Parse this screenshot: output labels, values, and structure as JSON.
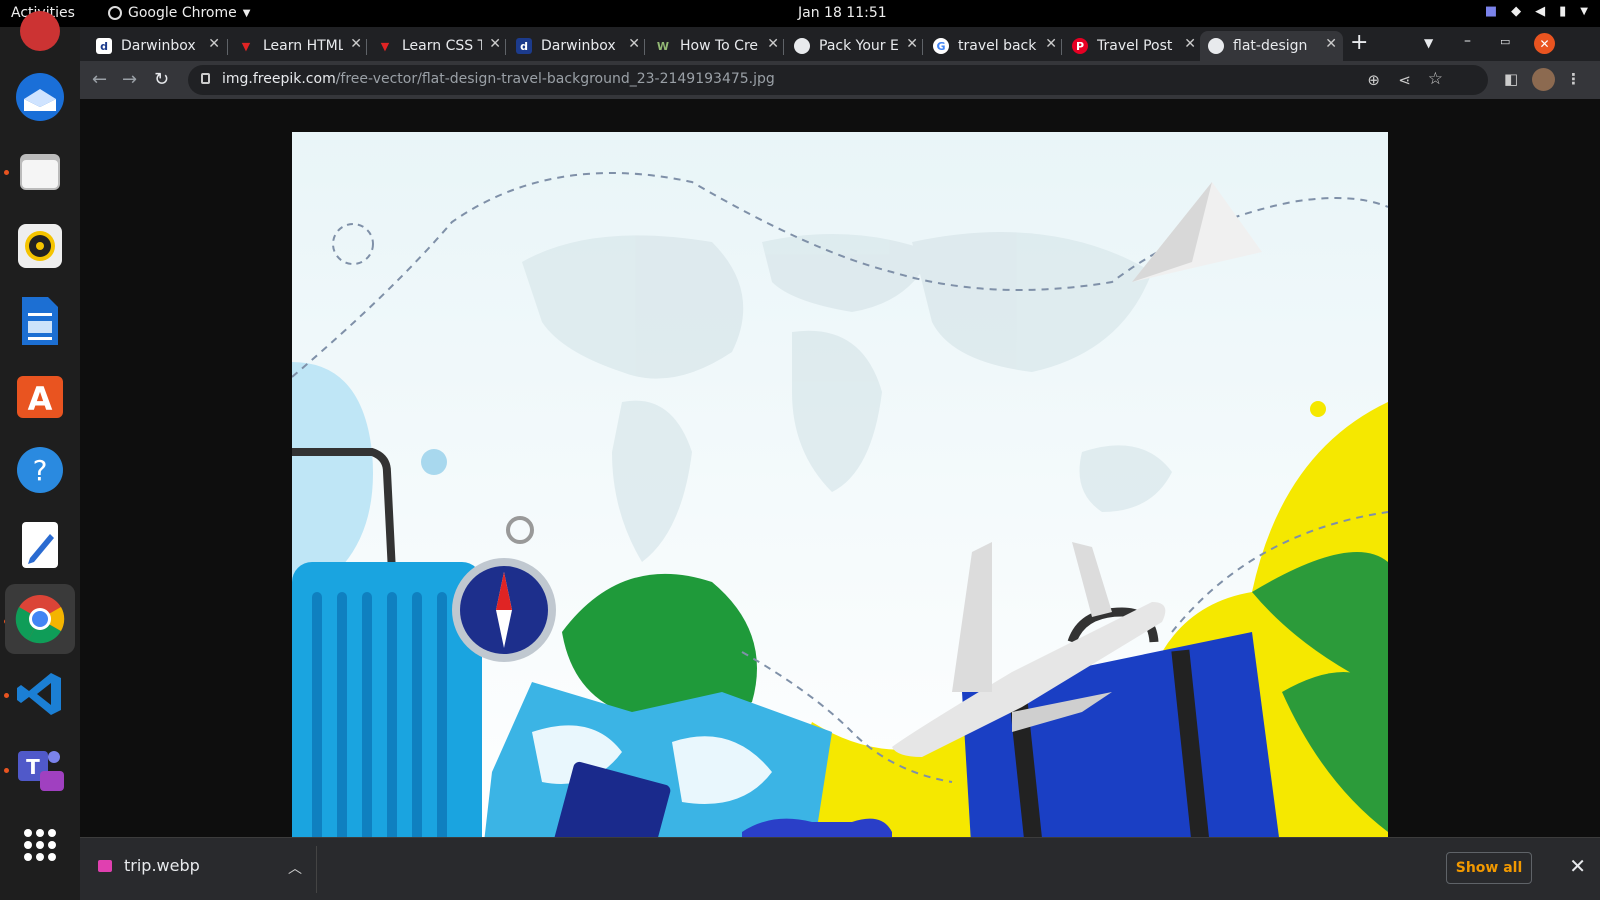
{
  "topbar": {
    "activities": "Activities",
    "app_name": "Google Chrome",
    "clock": "Jan 18  11:51"
  },
  "dock": {
    "items": [
      "thunderbird-icon",
      "files-icon",
      "rhythmbox-icon",
      "writer-icon",
      "software-icon",
      "help-icon",
      "text-editor-icon",
      "chrome-icon",
      "vscode-icon",
      "teams-icon",
      "app-grid-icon"
    ]
  },
  "browser": {
    "tabs": [
      {
        "title": "Darwinbox",
        "favicon": "darwinbox"
      },
      {
        "title": "Learn HTML",
        "favicon": "learn"
      },
      {
        "title": "Learn CSS T",
        "favicon": "learn"
      },
      {
        "title": "Darwinbox",
        "favicon": "darwinbox"
      },
      {
        "title": "How To Cre",
        "favicon": "wikihow"
      },
      {
        "title": "Pack Your E",
        "favicon": "globe"
      },
      {
        "title": "travel back",
        "favicon": "google"
      },
      {
        "title": "Travel Post",
        "favicon": "pinterest"
      },
      {
        "title": "flat-design",
        "favicon": "globe",
        "active": true
      }
    ],
    "url_host": "img.freepik.com",
    "url_path": "/free-vector/flat-design-travel-background_23-2149193475.jpg"
  },
  "downloads": {
    "file_name": "trip.webp",
    "show_all": "Show all"
  },
  "colors": {
    "accent_orange": "#e95420",
    "show_all_color": "#f29900",
    "suitcase_blue": "#1a3fc4",
    "luggage_cyan": "#1aa4e0",
    "yellow_blob": "#f5e800"
  }
}
